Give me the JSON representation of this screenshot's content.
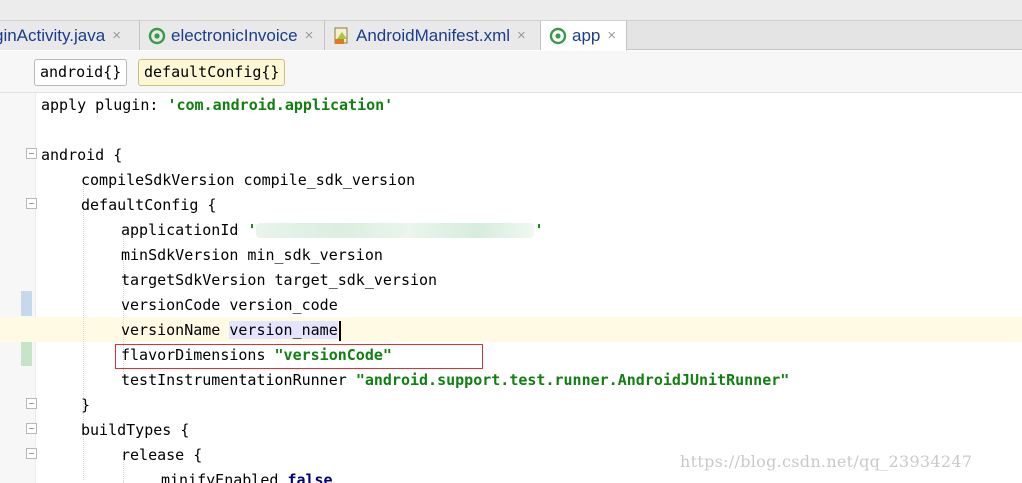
{
  "tabs": [
    {
      "label": "ginActivity.java",
      "icon": "java-class-icon",
      "active": false
    },
    {
      "label": "electronicInvoice",
      "icon": "gradle-module-icon",
      "active": false
    },
    {
      "label": "AndroidManifest.xml",
      "icon": "manifest-file-icon",
      "active": false
    },
    {
      "label": "app",
      "icon": "gradle-module-icon",
      "active": true
    }
  ],
  "close_glyph": "×",
  "breadcrumbs": [
    "android{}",
    "defaultConfig{}"
  ],
  "code": {
    "l1_a": "apply",
    "l1_b": " plugin: ",
    "l1_c": "'com.android.application'",
    "l3": "android {",
    "l4": "compileSdkVersion compile_sdk_version",
    "l5": "defaultConfig {",
    "l6_a": "applicationId ",
    "l6_q1": "'",
    "l6_q2": "'",
    "l7": "minSdkVersion min_sdk_version",
    "l8": "targetSdkVersion target_sdk_version",
    "l9": "versionCode version_code",
    "l10_a": "versionName ",
    "l10_b": "version_name",
    "l11_a": "flavorDimensions ",
    "l11_b": "\"versionCode\"",
    "l12_a": "testInstrumentationRunner ",
    "l12_b": "\"android.support.test.runner.AndroidJUnitRunner\"",
    "l13": "}",
    "l14": "buildTypes {",
    "l15": "release {",
    "l16_a": "minifyEnabled ",
    "l16_b": "false"
  },
  "watermark": "https://blog.csdn.net/qq_23934247",
  "colors": {
    "string": "#118011",
    "keyword": "#000080",
    "highlight_box": "#e03030",
    "caret_line": "#fffae3"
  }
}
